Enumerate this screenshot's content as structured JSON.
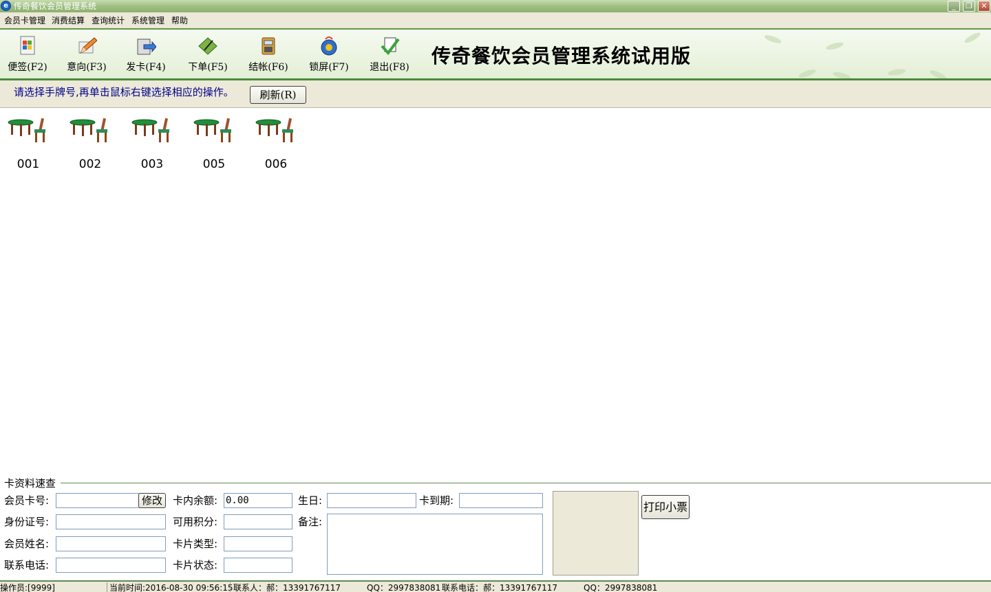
{
  "window": {
    "title": "传奇餐饮会员管理系统",
    "app_icon_glyph": "e",
    "minimize_glyph": "_",
    "restore_glyph": "❐",
    "close_glyph": "✕"
  },
  "menu": [
    "会员卡管理",
    "消费结算",
    "查询统计",
    "系统管理",
    "帮助"
  ],
  "toolbar": {
    "items": [
      {
        "label": "便签(F2)",
        "icon": "note-icon"
      },
      {
        "label": "意向(F3)",
        "icon": "pencil-icon"
      },
      {
        "label": "发卡(F4)",
        "icon": "card-issue-icon"
      },
      {
        "label": "下单(F5)",
        "icon": "order-icon"
      },
      {
        "label": "结帐(F6)",
        "icon": "checkout-icon"
      },
      {
        "label": "锁屏(F7)",
        "icon": "lock-screen-icon"
      },
      {
        "label": "退出(F8)",
        "icon": "exit-icon"
      }
    ],
    "brand": "传奇餐饮会员管理系统试用版"
  },
  "hint": {
    "text": "请选择手牌号,再单击鼠标右键选择相应的操作。",
    "refresh_label": "刷新(R)"
  },
  "tables": [
    "001",
    "002",
    "003",
    "005",
    "006"
  ],
  "lookup": {
    "title": "卡资料速查",
    "card_no_label": "会员卡号:",
    "card_no_value": "",
    "modify_label": "修改",
    "balance_label": "卡内余额:",
    "balance_value": "0.00",
    "birthday_label": "生日:",
    "birthday_value": "",
    "expire_label": "卡到期:",
    "expire_value": "",
    "id_label": "身份证号:",
    "id_value": "",
    "points_label": "可用积分:",
    "points_value": "",
    "remark_label": "备注:",
    "remark_value": "",
    "name_label": "会员姓名:",
    "name_value": "",
    "card_type_label": "卡片类型:",
    "card_type_value": "",
    "phone_label": "联系电话:",
    "phone_value": "",
    "card_status_label": "卡片状态:",
    "card_status_value": "",
    "print_label": "打印小票"
  },
  "status": {
    "operator": "操作员:[9999]",
    "current_time": "当前时间:2016-08-30 09:56:15",
    "contact": "联系人：郝：13391767117",
    "qq1": "QQ：2997838081",
    "phone": "联系电话：郝：13391767117",
    "qq2": "QQ：2997838081"
  }
}
